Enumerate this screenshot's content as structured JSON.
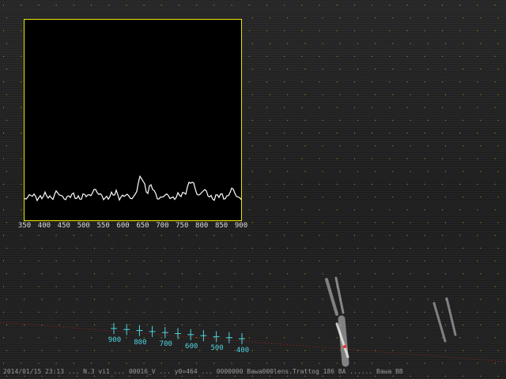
{
  "spectrum": {
    "axis_labels": [
      "350",
      "400",
      "450",
      "500",
      "550",
      "600",
      "650",
      "700",
      "750",
      "800",
      "850",
      "900"
    ],
    "x_range": [
      350,
      900
    ],
    "trace_color": "#ffffff",
    "frame_color": "#e8e800"
  },
  "calibration": {
    "labels": [
      "900",
      "800",
      "700",
      "600",
      "500",
      "400"
    ],
    "marker_color": "#4fd6e0"
  },
  "meteor": {
    "trail_color": "#d9d9d9",
    "trajectory_color": "#cc2222"
  },
  "grid_color": "#c8c800",
  "status_text": "2014/01/15 23:13 ... N.3 vi1 ... 00016_V ... y0=464 ... 0000000 Bawa000lens.Trattog 186 BA ...... Bawa BB"
}
